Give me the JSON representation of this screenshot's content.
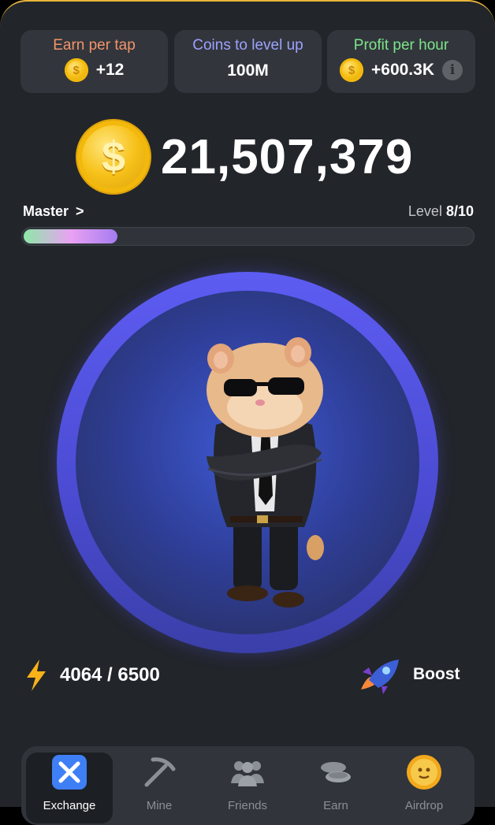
{
  "stats": [
    {
      "label": "Earn per tap",
      "value": "+12",
      "label_color": "#f2946a",
      "icon": "coin-icon"
    },
    {
      "label": "Coins to level up",
      "value": "100M",
      "label_color": "#9da2ff",
      "icon": null
    },
    {
      "label": "Profit per hour",
      "value": "+600.3K",
      "label_color": "#7de58a",
      "icon": "coin-icon",
      "info_icon": "i"
    }
  ],
  "balance": {
    "value": "21,507,379",
    "coin_symbol": "$"
  },
  "level": {
    "name": "Master",
    "chevron": ">",
    "prefix": "Level",
    "current": "8/10",
    "progress_fraction": 0.21
  },
  "energy": {
    "value": "4064 / 6500",
    "icon": "lightning-icon"
  },
  "boost": {
    "label": "Boost",
    "icon": "rocket-icon"
  },
  "mascot": {
    "icon": "hamster-icon"
  },
  "nav": [
    {
      "label": "Exchange",
      "icon": "exchange-icon",
      "active": true
    },
    {
      "label": "Mine",
      "icon": "pickaxe-icon",
      "active": false
    },
    {
      "label": "Friends",
      "icon": "friends-icon",
      "active": false
    },
    {
      "label": "Earn",
      "icon": "coins-stack-icon",
      "active": false
    },
    {
      "label": "Airdrop",
      "icon": "airdrop-coin-icon",
      "active": false
    }
  ],
  "colors": {
    "accent_gold": "#e8b53a",
    "background": "#22252a",
    "card": "#32363c",
    "tap_ring": "#5d5cf2"
  }
}
